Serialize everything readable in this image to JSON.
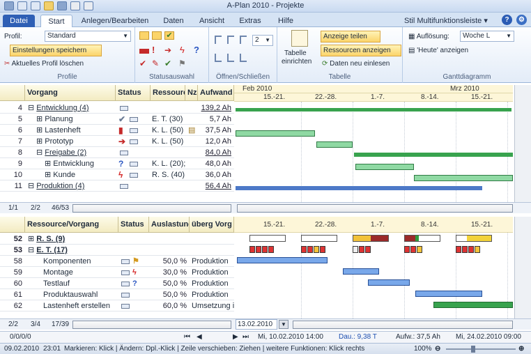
{
  "window": {
    "title": "A-Plan 2010 - Projekte"
  },
  "tabs": [
    "Datei",
    "Start",
    "Anlegen/Bearbeiten",
    "Daten",
    "Ansicht",
    "Extras",
    "Hilfe"
  ],
  "style_menu": "Stil Multifunktionsleiste",
  "ribbon": {
    "profile_label": "Profil:",
    "profile_value": "Standard",
    "save_settings": "Einstellungen speichern",
    "delete_profile": "Aktuelles Profil löschen",
    "group_profile": "Profile",
    "group_status": "Statusauswahl",
    "group_open": "Öffnen/Schließen",
    "open_level": "2",
    "table_setup_1": "Tabelle",
    "table_setup_2": "einrichten",
    "show_parts": "Anzeige teilen",
    "show_resources": "Ressourcen anzeigen",
    "reload": "Daten neu einlesen",
    "group_table": "Tabelle",
    "resolution_label": "Auflösung:",
    "resolution_value": "Woche L",
    "show_today": "'Heute' anzeigen",
    "group_gantt": "Ganttdiagramm"
  },
  "upper": {
    "headers": {
      "task": "Vorgang",
      "status": "Status",
      "resource": "Ressourc",
      "nz": "Nz",
      "effort": "Aufwand"
    },
    "months": [
      "Feb 2010",
      "Mrz 2010"
    ],
    "weeks": [
      "15.-21.",
      "22.-28.",
      "1.-7.",
      "8.-14.",
      "15.-21."
    ],
    "rows": [
      {
        "id": "4",
        "name": "Entwicklung (4)",
        "resource": "",
        "effort": "139,2 Ah"
      },
      {
        "id": "5",
        "name": "Planung",
        "resource": "E. T. (30)",
        "effort": "5,7 Ah"
      },
      {
        "id": "6",
        "name": "Lastenheft",
        "resource": "K. L. (50)",
        "effort": "37,5 Ah"
      },
      {
        "id": "7",
        "name": "Prototyp",
        "resource": "K. L. (50)",
        "effort": "12,0 Ah"
      },
      {
        "id": "8",
        "name": "Freigabe (2)",
        "resource": "",
        "effort": "84,0 Ah"
      },
      {
        "id": "9",
        "name": "Entwicklung",
        "resource": "K. L. (20);",
        "effort": "48,0 Ah"
      },
      {
        "id": "10",
        "name": "Kunde",
        "resource": "R. S. (40)",
        "effort": "36,0 Ah"
      },
      {
        "id": "11",
        "name": "Produktion (4)",
        "resource": "",
        "effort": "56,4 Ah"
      }
    ],
    "footer": [
      "1/1",
      "2/2",
      "46/53"
    ]
  },
  "lower": {
    "headers": {
      "resource": "Ressource/Vorgang",
      "status": "Status",
      "load": "Auslastung",
      "over": "überg Vorg"
    },
    "weeks": [
      "15.-21.",
      "22.-28.",
      "1.-7.",
      "8.-14.",
      "15.-21."
    ],
    "rows": [
      {
        "id": "52",
        "name": "R. S. (9)",
        "load": "",
        "over": ""
      },
      {
        "id": "53",
        "name": "E. T. (17)",
        "load": "",
        "over": ""
      },
      {
        "id": "58",
        "name": "Komponenten",
        "load": "50,0 %",
        "over": "Produktion"
      },
      {
        "id": "59",
        "name": "Montage",
        "load": "30,0 %",
        "over": "Produktion"
      },
      {
        "id": "60",
        "name": "Testlauf",
        "load": "50,0 %",
        "over": "Produktion"
      },
      {
        "id": "61",
        "name": "Produktauswahl",
        "load": "50,0 %",
        "over": "Produktion"
      },
      {
        "id": "62",
        "name": "Lastenheft erstellen",
        "load": "60,0 %",
        "over": "Umsetzung in"
      }
    ],
    "footer": [
      "2/2",
      "3/4",
      "17/39"
    ],
    "date_value": "13.02.2010"
  },
  "infobar": {
    "pos": "0/0/0/0",
    "start": "Mi, 10.02.2010 14:00",
    "duration": "Dau.: 9,38 T",
    "effort": "Aufw.: 37,5 Ah",
    "end": "Mi, 24.02.2010 09:00"
  },
  "statusbar": {
    "date": "09.02.2010",
    "time": "23:01",
    "hint": "Markieren: Klick  |  Ändern: Dpl.-Klick  |  Zeile verschieben: Ziehen  |  weitere Funktionen: Klick rechts",
    "zoom": "100%"
  }
}
